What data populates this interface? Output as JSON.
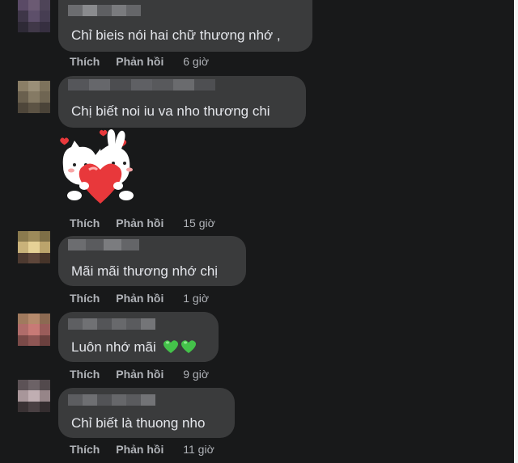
{
  "comments": [
    {
      "text": "Chỉ bieis nói hai chữ thương nhớ ,",
      "like": "Thích",
      "reply": "Phản hồi",
      "time": "6 giờ"
    },
    {
      "text": "Chị biết noi iu va nho thương chi",
      "like": "Thích",
      "reply": "Phản hồi",
      "time": "15 giờ"
    },
    {
      "text": "Mãi mãi thương nhớ chị",
      "like": "Thích",
      "reply": "Phản hồi",
      "time": "1 giờ"
    },
    {
      "text": "Luôn nhớ mãi",
      "emoji": "green-hearts",
      "like": "Thích",
      "reply": "Phản hồi",
      "time": "9 giờ"
    },
    {
      "text": "Chỉ biết là thuong nho",
      "like": "Thích",
      "reply": "Phản hồi",
      "time": "11 giờ"
    }
  ],
  "colors": {
    "background": "#18191a",
    "bubble": "#3a3b3c",
    "text": "#e4e6eb",
    "meta": "#b0b3b8",
    "green_heart": "#44c24a",
    "red_heart": "#e8383b"
  },
  "icons": [
    "blurred-avatar",
    "sticker-cats-with-heart",
    "green-heart-icon"
  ]
}
